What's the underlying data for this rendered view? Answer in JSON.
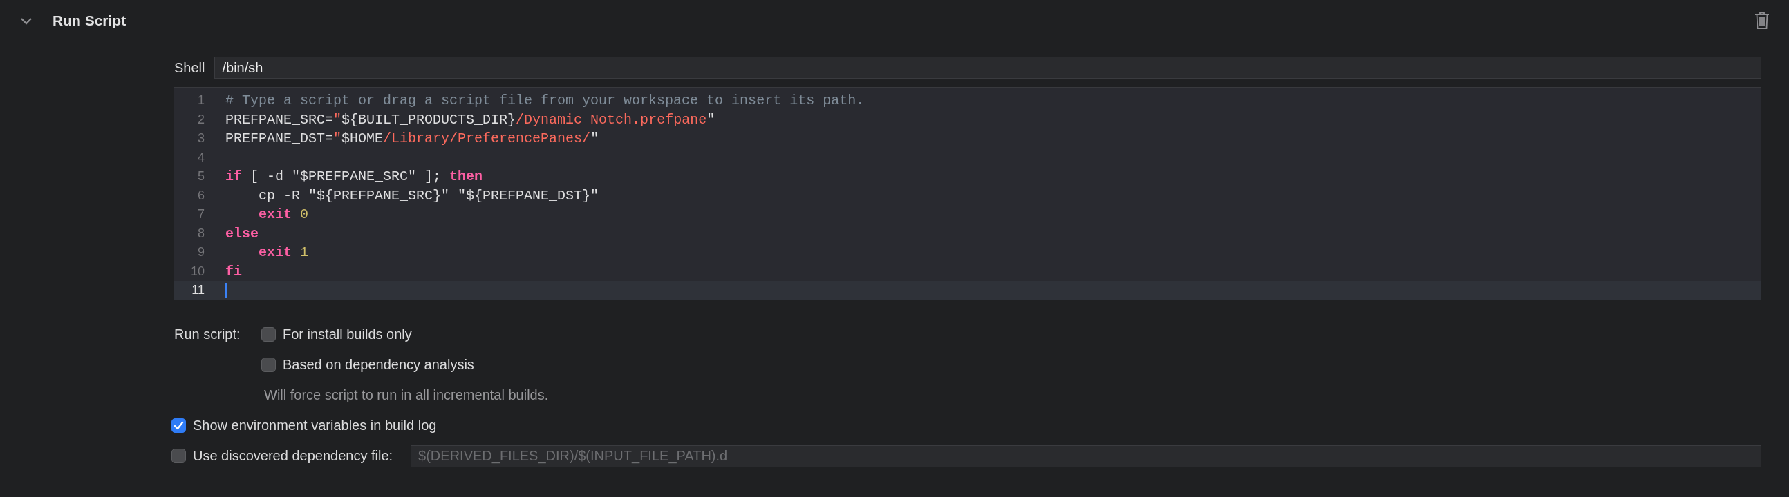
{
  "section": {
    "title": "Run Script",
    "expanded": true
  },
  "shell": {
    "label": "Shell",
    "value": "/bin/sh"
  },
  "editor": {
    "lines": [
      {
        "number": "1",
        "current": false,
        "tokens": [
          {
            "text": "# Type a script or drag a script file from your workspace to insert its path.",
            "kind": "comment"
          }
        ]
      },
      {
        "number": "2",
        "current": false,
        "tokens": [
          {
            "text": "PREFPANE_SRC=",
            "kind": "plain"
          },
          {
            "text": "\"",
            "kind": "string"
          },
          {
            "text": "${BUILT_PRODUCTS_DIR}",
            "kind": "plain"
          },
          {
            "text": "/Dynamic Notch.prefpane",
            "kind": "string"
          },
          {
            "text": "\"",
            "kind": "plain"
          }
        ]
      },
      {
        "number": "3",
        "current": false,
        "tokens": [
          {
            "text": "PREFPANE_DST=",
            "kind": "plain"
          },
          {
            "text": "\"",
            "kind": "string"
          },
          {
            "text": "$HOME",
            "kind": "plain"
          },
          {
            "text": "/Library/PreferencePanes/",
            "kind": "string"
          },
          {
            "text": "\"",
            "kind": "plain"
          }
        ]
      },
      {
        "number": "4",
        "current": false
      },
      {
        "number": "5",
        "current": false,
        "tokens": [
          {
            "text": "if",
            "kind": "keyword"
          },
          {
            "text": " [ -d \"$PREFPANE_SRC\" ]; ",
            "kind": "plain"
          },
          {
            "text": "then",
            "kind": "keyword"
          }
        ]
      },
      {
        "number": "6",
        "current": false,
        "tokens": [
          {
            "text": "    cp -R \"${PREFPANE_SRC}\" \"${PREFPANE_DST}\"",
            "kind": "plain"
          }
        ]
      },
      {
        "number": "7",
        "current": false,
        "tokens": [
          {
            "text": "    exit",
            "kind": "keyword"
          },
          {
            "text": " 0",
            "kind": "number"
          }
        ]
      },
      {
        "number": "8",
        "current": false,
        "tokens": [
          {
            "text": "else",
            "kind": "keyword"
          }
        ]
      },
      {
        "number": "9",
        "current": false,
        "tokens": [
          {
            "text": "    exit",
            "kind": "keyword"
          },
          {
            "text": " 1",
            "kind": "number"
          }
        ]
      },
      {
        "number": "10",
        "current": false,
        "tokens": [
          {
            "text": "fi",
            "kind": "keyword"
          }
        ]
      },
      {
        "number": "11",
        "current": true
      }
    ]
  },
  "run_script": {
    "label": "Run script:",
    "options": [
      {
        "label": "For install builds only",
        "checked": false
      },
      {
        "label": "Based on dependency analysis",
        "checked": false
      }
    ],
    "note": "Will force script to run in all incremental builds."
  },
  "show_env": {
    "label": "Show environment variables in build log",
    "checked": true
  },
  "dependency_file": {
    "label": "Use discovered dependency file:",
    "checked": false,
    "placeholder": "$(DERIVED_FILES_DIR)/$(INPUT_FILE_PATH).d"
  }
}
